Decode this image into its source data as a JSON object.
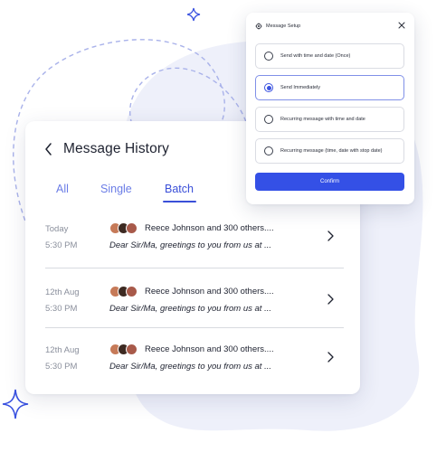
{
  "history": {
    "title": "Message History",
    "tabs": [
      {
        "label": "All",
        "active": false
      },
      {
        "label": "Single",
        "active": false
      },
      {
        "label": "Batch",
        "active": true
      }
    ],
    "rows": [
      {
        "date": "Today",
        "time": "5:30 PM",
        "recipients": "Reece Johnson and 300 others....",
        "preview": "Dear Sir/Ma, greetings to you from us at ..."
      },
      {
        "date": "12th Aug",
        "time": "5:30 PM",
        "recipients": "Reece Johnson and 300 others....",
        "preview": "Dear Sir/Ma, greetings to you from us at ..."
      },
      {
        "date": "12th Aug",
        "time": "5:30 PM",
        "recipients": "Reece Johnson and 300 others....",
        "preview": "Dear Sir/Ma, greetings to you from us at ..."
      }
    ]
  },
  "modal": {
    "title": "Message Setup",
    "options": [
      {
        "label": "Send with time and date (Once)",
        "selected": false
      },
      {
        "label": "Send Immediately",
        "selected": true
      },
      {
        "label": "Recurring message with time and date",
        "selected": false
      },
      {
        "label": "Recurring message (time, date with stop date)",
        "selected": false
      }
    ],
    "confirm_label": "Confirm"
  },
  "colors": {
    "accent": "#3450e6",
    "tab_inactive": "#6b7de6",
    "blob": "#eef0fa",
    "dashed_line": "#a9b2ea",
    "sparkle": "#3a52e0"
  },
  "icons": {
    "back": "chevron-left-icon",
    "row_arrow": "chevron-right-icon",
    "modal_header": "gear-icon",
    "close": "close-icon",
    "decoration": "sparkle-icon"
  }
}
